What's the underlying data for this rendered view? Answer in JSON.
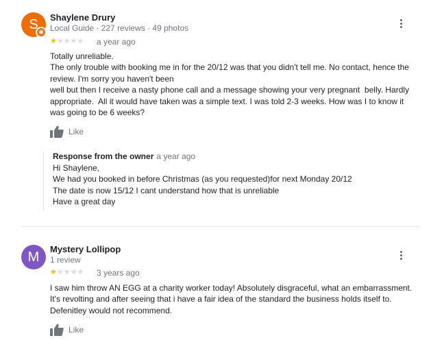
{
  "reviews": [
    {
      "author": "Shaylene Drury",
      "initial": "S",
      "avatar_color": "#ef6c00",
      "meta": "Local Guide · 227 reviews · 49 photos",
      "rating": 1,
      "rating_max": 5,
      "time": "a year ago",
      "text_lines": [
        "Totally unreliable.",
        "The only trouble with booking me in for the 20/12 was that you didn't tell me. No contact, hence the review. I'm sorry you haven't been",
        "well but then I receive a nasty phone call and a message showing your very pregnant  belly. Hardly appropriate.  All it would have taken was a simple text. I was told 2-3 weeks. How was I to know it was going to be 6 weeks?"
      ],
      "like_label": "Like",
      "response": {
        "title": "Response from the owner",
        "time": "a year ago",
        "lines": [
          "Hi Shaylene,",
          "We had you booked in before Christmas (as you requested)for next Monday 20/12",
          "The date is now 15/12 I cant understand how that is unreliable",
          "Have a great day"
        ]
      }
    },
    {
      "author": "Mystery Lollipop",
      "initial": "M",
      "avatar_color": "#7e57c2",
      "meta": "1 review",
      "rating": 1,
      "rating_max": 5,
      "time": "3 years ago",
      "text_lines": [
        "I saw him throw AN EGG at a charity worker today! Absolutely disgraceful, what an embarrassment. It's revolting and after seeing that i have a fair idea of the standard the business holds itself to. Defenitley would not recommend."
      ],
      "like_label": "Like"
    }
  ],
  "icons": {
    "local_guide_badge": "local-guide-badge-icon",
    "more": "more-vert-icon",
    "like": "thumbs-up-icon"
  }
}
